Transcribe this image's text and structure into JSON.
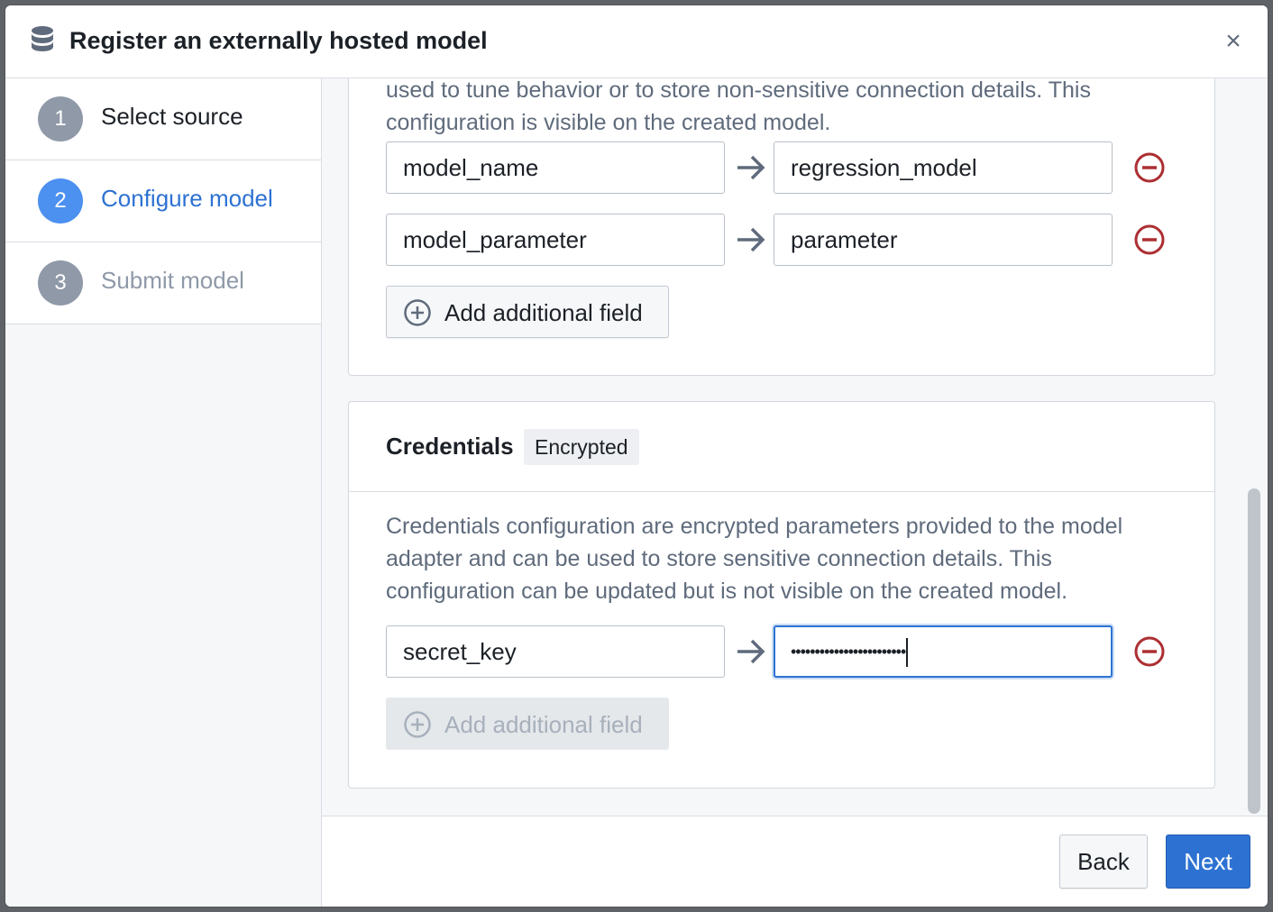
{
  "dialog": {
    "title": "Register an externally hosted model",
    "icon": "database-icon",
    "close_label": "×"
  },
  "steps": [
    {
      "number": "1",
      "label": "Select source",
      "state": "done"
    },
    {
      "number": "2",
      "label": "Configure model",
      "state": "active"
    },
    {
      "number": "3",
      "label": "Submit model",
      "state": "pending"
    }
  ],
  "colors": {
    "accent": "#2d72d2",
    "step_inactive": "#8f99a8",
    "danger": "#ac2f33",
    "muted_text": "#5f6b7c"
  },
  "configuration": {
    "description_partial_top": "used to tune behavior or to store non-sensitive connection details. This",
    "description_visible": "configuration is visible on the created model.",
    "fields": [
      {
        "key": "model_name",
        "value": "regression_model"
      },
      {
        "key": "model_parameter",
        "value": "parameter"
      }
    ],
    "add_label": "Add additional field"
  },
  "credentials": {
    "title": "Credentials",
    "tag": "Encrypted",
    "description_lines": [
      "Credentials configuration are encrypted parameters provided to the model",
      "adapter and can be used to store sensitive connection details. This",
      "configuration can be updated but is not visible on the created model."
    ],
    "fields": [
      {
        "key": "secret_key",
        "value": "••••••••••••••••••••••••"
      }
    ],
    "add_label": "Add additional field"
  },
  "footer": {
    "back_label": "Back",
    "next_label": "Next"
  }
}
